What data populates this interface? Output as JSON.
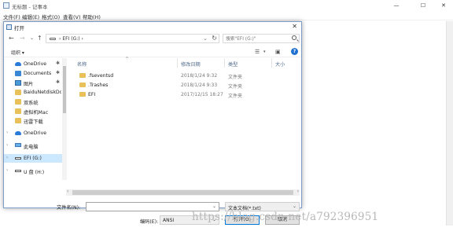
{
  "notepad": {
    "title": "无标题 - 记事本",
    "controls": [
      "—",
      "☐",
      "✕"
    ],
    "menu": [
      "文件(F)",
      "编辑(E)",
      "格式(O)",
      "查看(V)",
      "帮助(H)"
    ]
  },
  "dialog": {
    "title": "打开",
    "address": {
      "path": "EFI (G:)",
      "separator": "›",
      "search_placeholder": "搜索\"EFI (G:)\""
    },
    "toolbar": {
      "organize": "组织 ▾"
    },
    "nav_items": [
      {
        "label": "OneDrive",
        "icon": "cloud-icon",
        "pinned": true
      },
      {
        "label": "Documents",
        "icon": "folder-icon",
        "pinned": true
      },
      {
        "label": "图片",
        "icon": "pictures-icon",
        "pinned": true
      },
      {
        "label": "BaiduNetdiskDo",
        "icon": "folder-icon",
        "pinned": false
      },
      {
        "label": "双系统",
        "icon": "folder-icon",
        "pinned": false
      },
      {
        "label": "虚拟机Mac",
        "icon": "folder-icon",
        "pinned": false
      },
      {
        "label": "迅雷下载",
        "icon": "folder-icon",
        "pinned": false
      },
      {
        "label": "OneDrive",
        "icon": "cloud-icon",
        "pinned": false
      },
      {
        "label": "此电脑",
        "icon": "computer-icon",
        "pinned": false
      },
      {
        "label": "EFI (G:)",
        "icon": "drive-icon",
        "pinned": false
      },
      {
        "label": "U 盘 (H:)",
        "icon": "drive-icon",
        "pinned": false
      }
    ],
    "columns": {
      "name": "名称",
      "date": "修改日期",
      "type": "类型",
      "size": "大小"
    },
    "files": [
      {
        "name": ".fseventsd",
        "date": "2018/1/24 9:32",
        "type": "文件夹"
      },
      {
        "name": ".Trashes",
        "date": "2018/1/24 9:33",
        "type": "文件夹"
      },
      {
        "name": "EFI",
        "date": "2017/12/15 18:27",
        "type": "文件夹"
      }
    ],
    "footer": {
      "filename_label": "文件名(N):",
      "filename_value": "",
      "filetype_value": "文本文档(*.txt)",
      "encoding_label": "编码(E):",
      "encoding_value": "ANSI",
      "open_button": "打开(O)",
      "cancel_button": "取消"
    }
  },
  "watermark": "https://blog.csdn.net/a792396951",
  "colors": {
    "accent": "#0078d7",
    "selection": "#cce8ff",
    "folder": "#e8c15a",
    "help": "#1f6fd0"
  }
}
